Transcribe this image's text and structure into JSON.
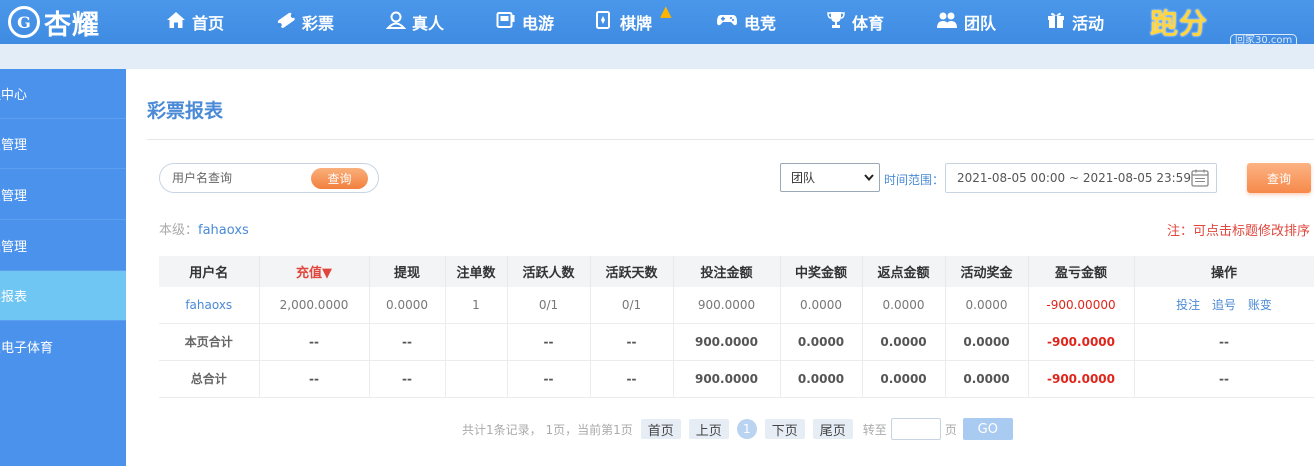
{
  "brand": {
    "logo_letter": "G",
    "name": "杏耀"
  },
  "nav": {
    "items": [
      {
        "label": "首页",
        "icon": "home-icon"
      },
      {
        "label": "彩票",
        "icon": "lottery-ticket-icon"
      },
      {
        "label": "真人",
        "icon": "live-dealer-icon"
      },
      {
        "label": "电游",
        "icon": "slot-machine-icon"
      },
      {
        "label": "棋牌",
        "icon": "cards-icon"
      },
      {
        "label": "电竞",
        "icon": "gamepad-icon"
      },
      {
        "label": "体育",
        "icon": "trophy-icon"
      },
      {
        "label": "团队",
        "icon": "team-icon"
      },
      {
        "label": "活动",
        "icon": "gift-icon"
      }
    ],
    "promo": "跑分",
    "watermark": "回家30.com"
  },
  "sidebar": {
    "items": [
      {
        "label": "理中心"
      },
      {
        "label": "人管理"
      },
      {
        "label": "人管理"
      },
      {
        "label": "表管理"
      },
      {
        "label": "票报表",
        "active": true
      },
      {
        "label": "人电子体育"
      }
    ]
  },
  "page": {
    "title": "彩票报表",
    "search": {
      "placeholder": "用户名查询",
      "button": "查询"
    },
    "team_select": {
      "value": "团队"
    },
    "time_label": "时间范围：",
    "date_range": "2021-08-05 00:00 ~ 2021-08-05 23:59",
    "query_button": "查询",
    "level_label": "本级：",
    "level_value": "fahaoxs",
    "note": "注：可点击标题修改排序"
  },
  "table": {
    "headers": [
      "用户名",
      "充值▼",
      "提现",
      "注单数",
      "活跃人数",
      "活跃天数",
      "投注金额",
      "中奖金额",
      "返点金额",
      "活动奖金",
      "盈亏金额",
      "操作"
    ],
    "row": {
      "user": "fahaoxs",
      "recharge": "2,000.0000",
      "withdraw": "0.0000",
      "orders": "1",
      "active_users": "0/1",
      "active_days": "0/1",
      "bet": "900.0000",
      "win": "0.0000",
      "rebate": "0.0000",
      "bonus": "0.0000",
      "profit": "-900.00000",
      "ops": [
        "投注",
        "追号",
        "账变"
      ]
    },
    "page_total": {
      "label": "本页合计",
      "recharge": "--",
      "withdraw": "--",
      "orders": "",
      "active_users": "--",
      "active_days": "--",
      "bet": "900.0000",
      "win": "0.0000",
      "rebate": "0.0000",
      "bonus": "0.0000",
      "profit": "-900.0000",
      "ops": "--"
    },
    "grand_total": {
      "label": "总合计",
      "recharge": "--",
      "withdraw": "--",
      "orders": "",
      "active_users": "--",
      "active_days": "--",
      "bet": "900.0000",
      "win": "0.0000",
      "rebate": "0.0000",
      "bonus": "0.0000",
      "profit": "-900.0000",
      "ops": "--"
    }
  },
  "pager": {
    "summary": "共计1条记录， 1页，当前第1页",
    "first": "首页",
    "prev": "上页",
    "current": "1",
    "next": "下页",
    "last": "尾页",
    "goto_label": "转至",
    "page_unit": "页",
    "go": "GO"
  }
}
